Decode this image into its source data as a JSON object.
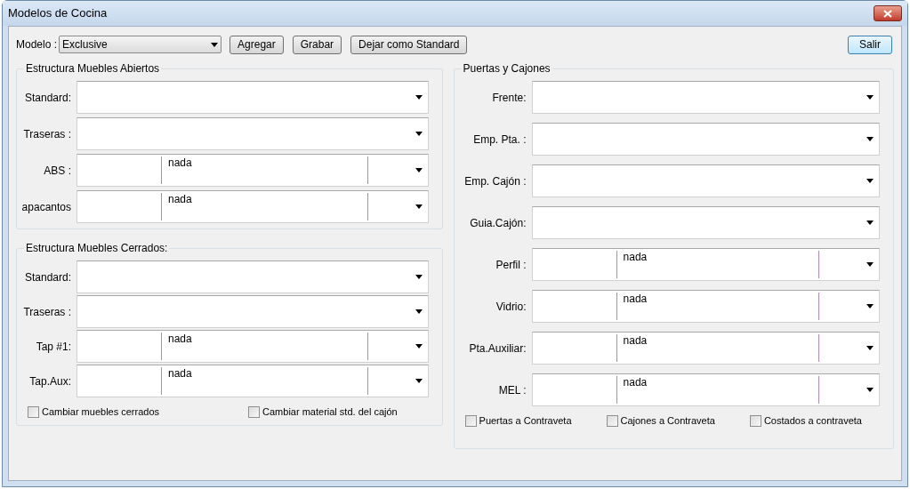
{
  "window": {
    "title": "Modelos de Cocina"
  },
  "toolbar": {
    "model_label": "Modelo :",
    "model_value": "Exclusive",
    "buttons": [
      "Agregar",
      "Grabar",
      "Dejar como Standard"
    ],
    "exit_button": "Salir"
  },
  "groups": [
    {
      "title": "Estructura Muebles Abiertos",
      "fields": [
        {
          "label": "Standard:",
          "kind": "combo"
        },
        {
          "label": "Traseras :",
          "kind": "combo"
        },
        {
          "label": "ABS :",
          "kind": "split",
          "value": "nada"
        },
        {
          "label": "apacantos",
          "kind": "split",
          "value": "nada"
        }
      ]
    },
    {
      "title": "Estructura Muebles Cerrados:",
      "fields": [
        {
          "label": "Standard:",
          "kind": "combo"
        },
        {
          "label": "Traseras :",
          "kind": "combo"
        },
        {
          "label": "Tap #1:",
          "kind": "split",
          "value": "nada"
        },
        {
          "label": "Tap.Aux:",
          "kind": "split",
          "value": "nada"
        }
      ],
      "checkboxes": [
        {
          "label": "Cambiar muebles cerrados",
          "checked": false
        },
        {
          "label": "Cambiar material std. del cajón",
          "checked": false
        }
      ]
    },
    {
      "title": "Puertas y Cajones",
      "fields": [
        {
          "label": "Frente:",
          "kind": "combo"
        },
        {
          "label": "Emp. Pta. :",
          "kind": "combo"
        },
        {
          "label": "Emp. Cajón :",
          "kind": "combo"
        },
        {
          "label": "Guia.Cajón:",
          "kind": "combo"
        },
        {
          "label": "Perfil :",
          "kind": "split",
          "value": "nada"
        },
        {
          "label": "Vidrio:",
          "kind": "split",
          "value": "nada"
        },
        {
          "label": "Pta.Auxiliar:",
          "kind": "split",
          "value": "nada"
        },
        {
          "label": "MEL :",
          "kind": "split",
          "value": "nada"
        }
      ],
      "checkboxes": [
        {
          "label": "Puertas a Contraveta",
          "checked": false
        },
        {
          "label": "Cajones a Contraveta",
          "checked": false
        },
        {
          "label": "Costados a contraveta",
          "checked": false
        }
      ]
    }
  ]
}
